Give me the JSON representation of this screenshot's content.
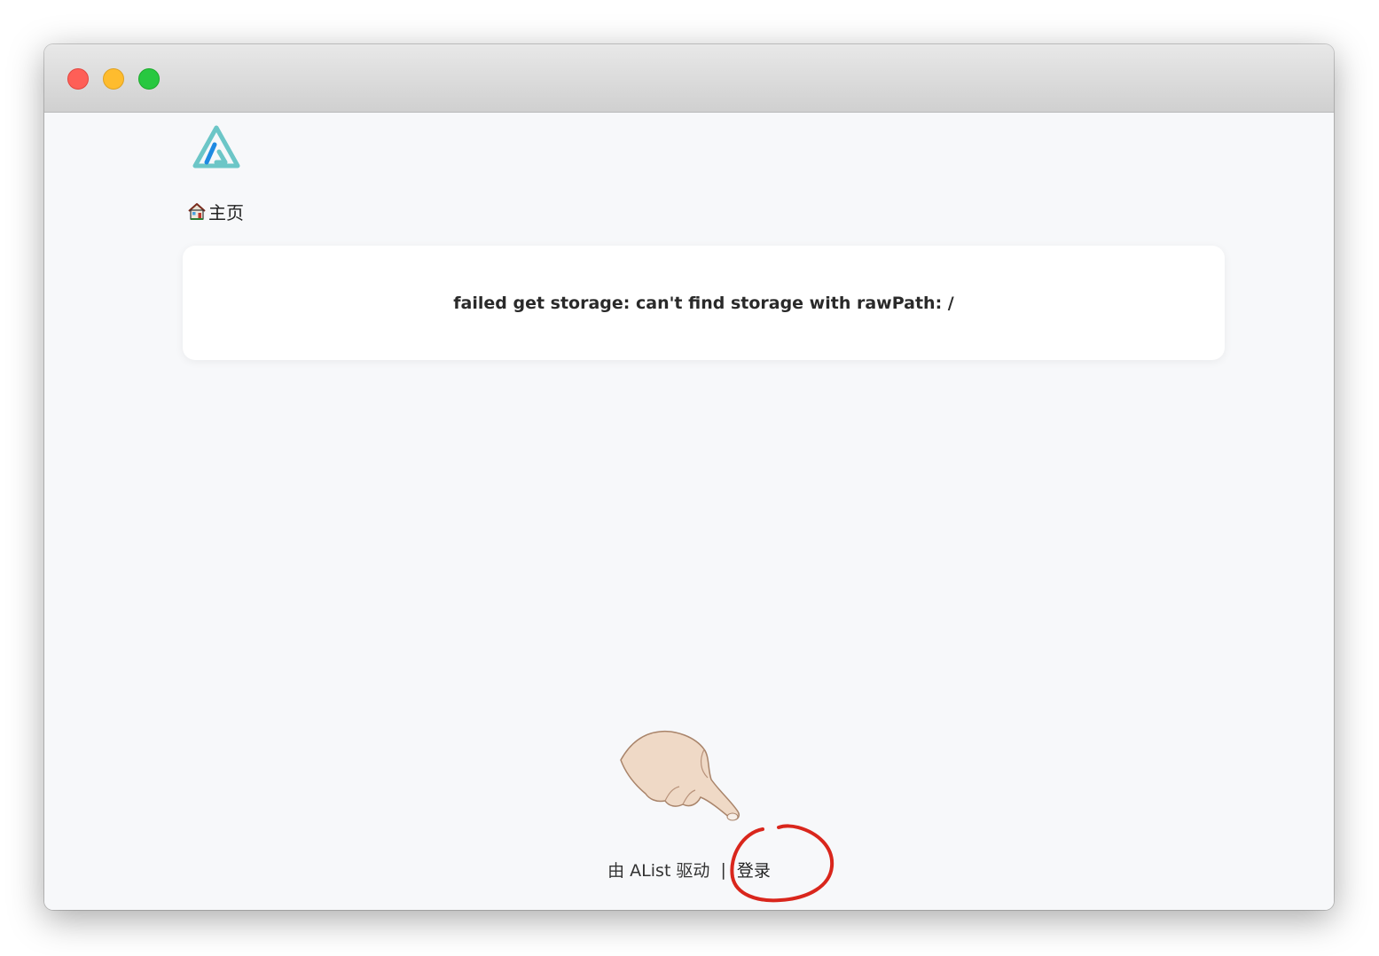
{
  "window": {
    "controls": [
      "close",
      "minimize",
      "maximize"
    ]
  },
  "header": {
    "logo": "alist-logo-icon",
    "breadcrumb": {
      "home_icon": "house-icon",
      "home_label": "主页"
    }
  },
  "main": {
    "error_message": "failed get storage: can't find storage with rawPath: /"
  },
  "footer": {
    "powered_by": "由 AList 驱动",
    "separator": "|",
    "login_label": "登录"
  },
  "annotations": {
    "pointer": "pointing-hand-icon",
    "highlight": "red-circle-highlight"
  },
  "colors": {
    "close": "#fe5f57",
    "minimize": "#febc2e",
    "maximize": "#28c840",
    "logo_teal": "#6cc6c7",
    "logo_blue": "#1f8ae2",
    "highlight_red": "#d9261c",
    "background": "#f7f8fa"
  }
}
